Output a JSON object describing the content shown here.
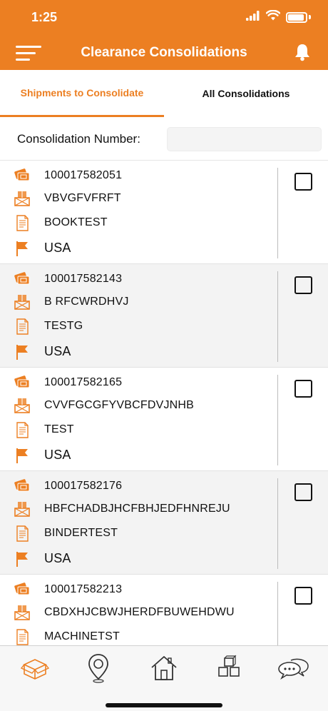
{
  "status_bar": {
    "time": "1:25"
  },
  "header": {
    "title": "Clearance Consolidations"
  },
  "tabs": [
    {
      "label": "Shipments to Consolidate",
      "active": true
    },
    {
      "label": "All Consolidations",
      "active": false
    }
  ],
  "consolidation": {
    "label": "Consolidation Number:",
    "value": "",
    "placeholder": ""
  },
  "shipments": [
    {
      "number": "100017582051",
      "code": "VBVGFVFRFT",
      "description": "BOOKTEST",
      "country": "USA",
      "checked": false
    },
    {
      "number": "100017582143",
      "code": "B RFCWRDHVJ",
      "description": "TESTG",
      "country": "USA",
      "checked": false
    },
    {
      "number": "100017582165",
      "code": "CVVFGCGFYVBCFDVJNHB",
      "description": "TEST",
      "country": "USA",
      "checked": false
    },
    {
      "number": "100017582176",
      "code": "HBFCHADBJHCFBHJEDFHNREJU",
      "description": "BINDERTEST",
      "country": "USA",
      "checked": false
    },
    {
      "number": "100017582213",
      "code": "CBDXHJCBWJHERDFBUWEHDWU",
      "description": "MACHINETST",
      "country": "",
      "checked": false
    }
  ],
  "bottom_nav": [
    {
      "name": "consolidate-tab",
      "icon": "open-box-icon",
      "active": true
    },
    {
      "name": "tracking-tab",
      "icon": "location-pin-icon",
      "active": false
    },
    {
      "name": "home-tab",
      "icon": "home-icon",
      "active": false
    },
    {
      "name": "packages-tab",
      "icon": "stacked-boxes-icon",
      "active": false
    },
    {
      "name": "chat-tab",
      "icon": "chat-bubbles-icon",
      "active": false
    }
  ],
  "colors": {
    "accent": "#ec7f22",
    "header_text": "#ffffff",
    "alt_row": "#f3f3f3",
    "text": "#111111"
  }
}
